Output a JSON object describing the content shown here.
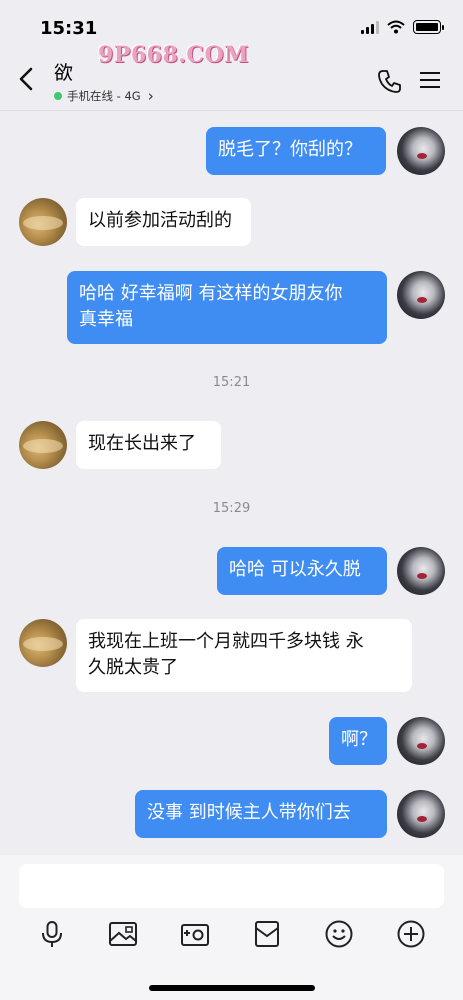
{
  "status_bar": {
    "time": "15:31"
  },
  "header": {
    "title": "欲",
    "subtitle": "手机在线 - 4G",
    "subtitle_arrow": "›",
    "watermark": "9P668.COM",
    "icons": [
      "back-arrow-icon",
      "phone-icon",
      "menu-icon"
    ]
  },
  "messages": [
    {
      "from": "me",
      "text": "脱毛了？你刮的？"
    },
    {
      "from": "other",
      "text": "以前参加活动刮的"
    },
    {
      "from": "me",
      "text_line1": "哈哈 好幸福啊 有这样的女朋友你",
      "text_line2": "真幸福"
    },
    {
      "type": "time",
      "text": "15:21"
    },
    {
      "from": "other",
      "text": "现在长出来了"
    },
    {
      "type": "time",
      "text": "15:29"
    },
    {
      "from": "me",
      "text": "哈哈 可以永久脱"
    },
    {
      "from": "other",
      "text_line1": "我现在上班一个月就四千多块钱 永",
      "text_line2": "久脱太贵了"
    },
    {
      "from": "me",
      "text": "啊？"
    },
    {
      "from": "me",
      "text": "没事 到时候主人带你们去"
    }
  ],
  "input": {
    "placeholder": ""
  },
  "toolbar": [
    "microphone-icon",
    "image-icon",
    "camera-icon",
    "red-packet-icon",
    "emoji-icon",
    "add-icon"
  ],
  "colors": {
    "bubble_me": "#3f8cf2",
    "bubble_other": "#ffffff",
    "background": "#ededf2"
  }
}
